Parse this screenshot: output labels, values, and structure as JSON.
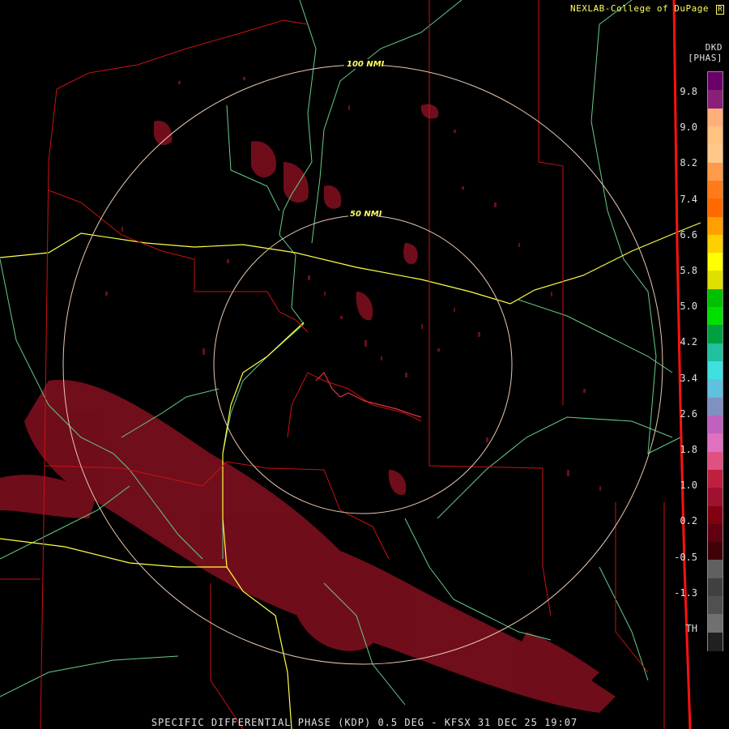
{
  "header": {
    "credit": "NEXLAB-College of DuPage",
    "credit_logo": "R",
    "product_code": "DKD",
    "product_unit": "[PHAS]"
  },
  "footer": {
    "caption": "SPECIFIC DIFFERENTIAL PHASE (KDP) 0.5 DEG - KFSX 31 DEC 25 19:07"
  },
  "range_rings": [
    {
      "label": "100 NMI"
    },
    {
      "label": "50 NMI"
    }
  ],
  "legend": {
    "ticks": [
      "9.8",
      "9.0",
      "8.2",
      "7.4",
      "6.6",
      "5.8",
      "5.0",
      "4.2",
      "3.4",
      "2.6",
      "1.8",
      "1.0",
      "0.2",
      "-0.5",
      "-1.3",
      "TH"
    ],
    "colors": [
      "#6a006a",
      "#8a1f7a",
      "#ffb07a",
      "#ffc27f",
      "#ffc889",
      "#ff9a4a",
      "#ff7a1a",
      "#ff6a00",
      "#ffa000",
      "#ffd000",
      "#ffff00",
      "#e0e000",
      "#00c000",
      "#00e000",
      "#00a040",
      "#20c0a0",
      "#40e0e0",
      "#60c0e0",
      "#8090c0",
      "#c060c0",
      "#e070c0",
      "#e05080",
      "#c02040",
      "#a01030",
      "#800010",
      "#600010",
      "#400008",
      "#606060",
      "#404040",
      "#505050",
      "#707070",
      "#202020"
    ],
    "colors_meta": "colour ramp from top to bottom"
  },
  "colors": {
    "echo": "#7a0f1e",
    "state_border": "#cc1111",
    "highway": "#ffff44",
    "road": "#66cc88",
    "ring": "#e8c8b0"
  }
}
